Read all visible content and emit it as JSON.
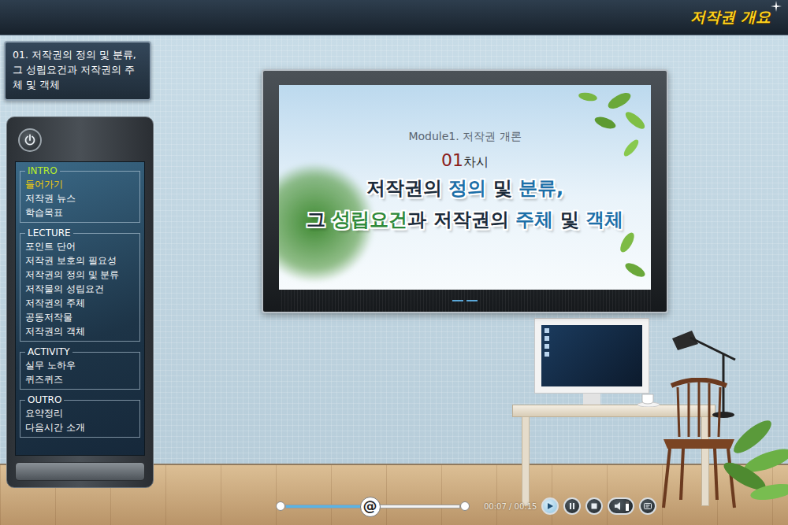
{
  "header": {
    "title": "저작권 개요"
  },
  "lesson_title": "01. 저작권의 정의 및 분류, 그 성립요건과 저작권의 주체 및 객체",
  "menu": [
    {
      "heading": "INTRO",
      "active": true,
      "items": [
        {
          "label": "들어가기",
          "selected": true
        },
        {
          "label": "저작권 뉴스",
          "selected": false
        },
        {
          "label": "학습목표",
          "selected": false
        }
      ]
    },
    {
      "heading": "LECTURE",
      "active": false,
      "items": [
        {
          "label": "포인트 단어",
          "selected": false
        },
        {
          "label": "저작권 보호의 필요성",
          "selected": false
        },
        {
          "label": "저작권의 정의 및 분류",
          "selected": false
        },
        {
          "label": "저작물의 성립요건",
          "selected": false
        },
        {
          "label": "저작권의 주체",
          "selected": false
        },
        {
          "label": "공동저작물",
          "selected": false
        },
        {
          "label": "저작권의 객체",
          "selected": false
        }
      ]
    },
    {
      "heading": "ACTIVITY",
      "active": false,
      "items": [
        {
          "label": "실무 노하우",
          "selected": false
        },
        {
          "label": "퀴즈퀴즈",
          "selected": false
        }
      ]
    },
    {
      "heading": "OUTRO",
      "active": false,
      "items": [
        {
          "label": "요약정리",
          "selected": false
        },
        {
          "label": "다음시간 소개",
          "selected": false
        }
      ]
    }
  ],
  "screen": {
    "module": "Module1. 저작권 개론",
    "session_number": "01",
    "session_suffix": "차시",
    "title_lines": [
      [
        {
          "text": "저작권의 ",
          "color": "#1c2b3a"
        },
        {
          "text": "정의",
          "color": "#1d6fa8"
        },
        {
          "text": " 및 ",
          "color": "#1c2b3a"
        },
        {
          "text": "분류,",
          "color": "#1d6fa8"
        }
      ],
      [
        {
          "text": "그 ",
          "color": "#1c2b3a"
        },
        {
          "text": "성립요건",
          "color": "#2f8a3a"
        },
        {
          "text": "과 저작권의 ",
          "color": "#1c2b3a"
        },
        {
          "text": "주체",
          "color": "#1d6fa8"
        },
        {
          "text": " 및 ",
          "color": "#1c2b3a"
        },
        {
          "text": "객체",
          "color": "#1d6fa8"
        }
      ]
    ]
  },
  "player": {
    "knob": "@",
    "level": 0.48,
    "time": "00:07 / 00:15",
    "volume_level": 0.75
  }
}
